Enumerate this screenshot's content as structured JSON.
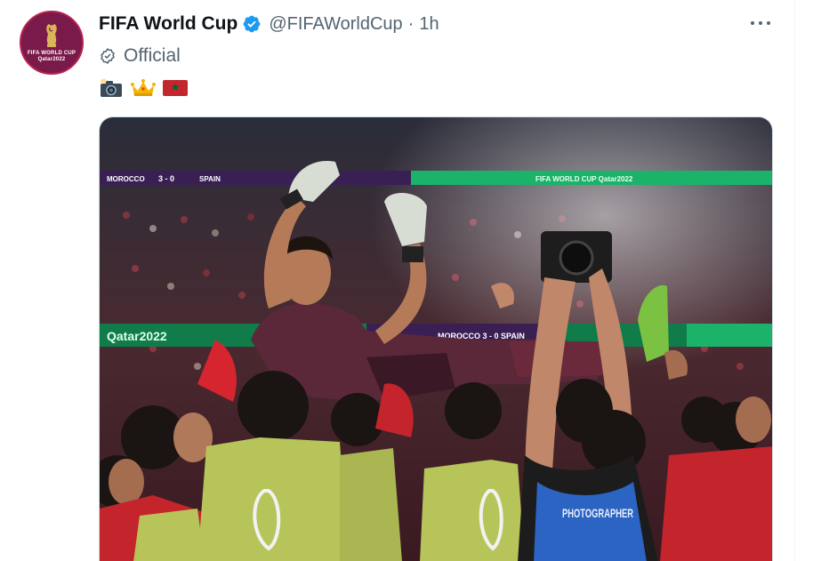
{
  "account": {
    "display_name": "FIFA World Cup",
    "handle": "@FIFAWorldCup",
    "separator": "·",
    "time": "1h",
    "official_label": "Official",
    "avatar_text_line1": "FIFA WORLD CUP",
    "avatar_text_line2": "Qatar2022"
  },
  "tweet": {
    "emojis": [
      "camera-with-flash",
      "crown",
      "morocco-flag"
    ]
  },
  "photo": {
    "scoreboard_left": "MOROCCO",
    "score": "3 - 0",
    "scoreboard_right": "SPAIN",
    "board_banner": "FIFA WORLD CUP Qatar2022",
    "board_left": "Qatar2022",
    "board_right": "MOROCCO 3 - 0 SPAIN",
    "vest_text": "PHOTOGRAPHER"
  },
  "colors": {
    "verified": "#1d9bf0",
    "secondary_text": "#536471",
    "avatar_bg": "#7a1a4a"
  }
}
